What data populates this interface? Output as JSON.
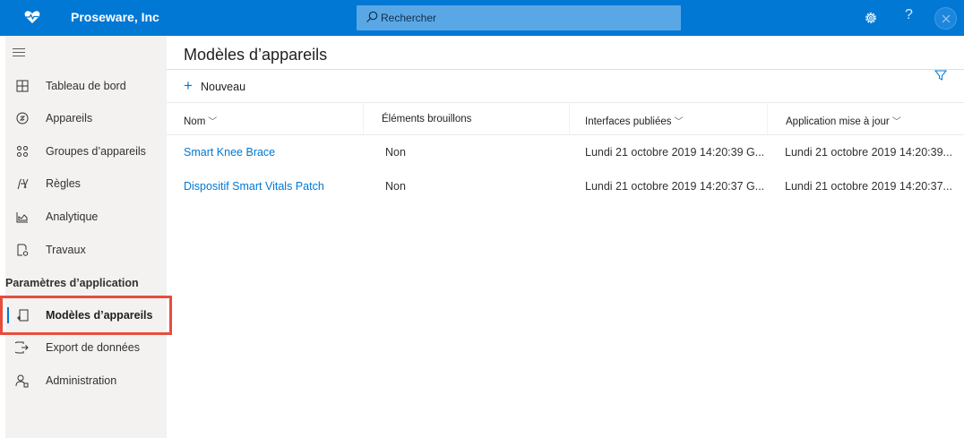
{
  "topbar": {
    "app_name": "Proseware, Inc",
    "search_placeholder": "Rechercher",
    "help_label": "?"
  },
  "sidebar": {
    "items": [
      {
        "label": "Tableau de bord",
        "icon": "dashboard-icon"
      },
      {
        "label": "Appareils",
        "icon": "devices-icon"
      },
      {
        "label": "Groupes d’appareils",
        "icon": "device-groups-icon"
      },
      {
        "label": "Règles",
        "icon": "rules-icon"
      },
      {
        "label": "Analytique",
        "icon": "analytics-icon"
      },
      {
        "label": "Travaux",
        "icon": "jobs-icon"
      }
    ],
    "section_label": "Paramètres d’application",
    "settings_items": [
      {
        "label": "Modèles d’appareils",
        "icon": "device-templates-icon",
        "active": true
      },
      {
        "label": "Export de données",
        "icon": "data-export-icon"
      },
      {
        "label": "Administration",
        "icon": "administration-icon"
      }
    ]
  },
  "main": {
    "title": "Modèles d’appareils",
    "new_button": "Nouveau",
    "columns": [
      "Nom",
      "Éléments brouillons",
      "Interfaces publiées",
      "Application mise à jour"
    ],
    "rows": [
      {
        "name": "Smart Knee Brace",
        "draft": "Non",
        "published": "Lundi 21 octobre 2019 14:20:39 G...",
        "updated": "Lundi 21 octobre 2019 14:20:39..."
      },
      {
        "name": "Dispositif Smart Vitals Patch",
        "draft": "Non",
        "published": "Lundi 21 octobre 2019 14:20:37 G...",
        "updated": "Lundi 21 octobre 2019 14:20:37..."
      }
    ]
  },
  "colors": {
    "brand": "#0078d4",
    "highlight": "#e84c3d"
  }
}
